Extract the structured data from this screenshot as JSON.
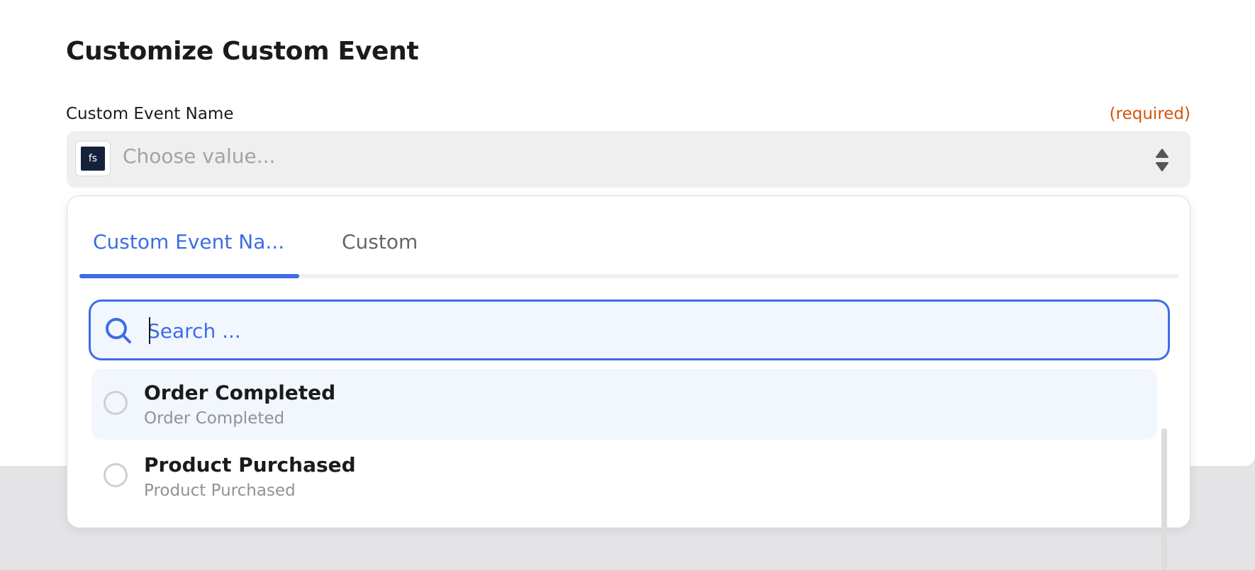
{
  "page": {
    "title": "Customize Custom Event"
  },
  "field": {
    "label": "Custom Event Name",
    "required_text": "(required)",
    "placeholder": "Choose value...",
    "app_icon_text": "fs"
  },
  "dropdown": {
    "tabs": [
      {
        "label": "Custom Event Na...",
        "active": true
      },
      {
        "label": "Custom",
        "active": false
      }
    ],
    "search": {
      "placeholder": "Search ...",
      "value": ""
    },
    "options": [
      {
        "label": "Order Completed",
        "sublabel": "Order Completed",
        "highlighted": true
      },
      {
        "label": "Product Purchased",
        "sublabel": "Product Purchased",
        "highlighted": false
      }
    ]
  },
  "colors": {
    "accent": "#3d6ce6",
    "required": "#d6530b",
    "app_icon_bg": "#15223a"
  },
  "icons": {
    "app": "fullstory-logo-icon",
    "select_arrows": "sort-arrows-icon",
    "search": "search-icon",
    "option_radio": "radio-icon"
  }
}
